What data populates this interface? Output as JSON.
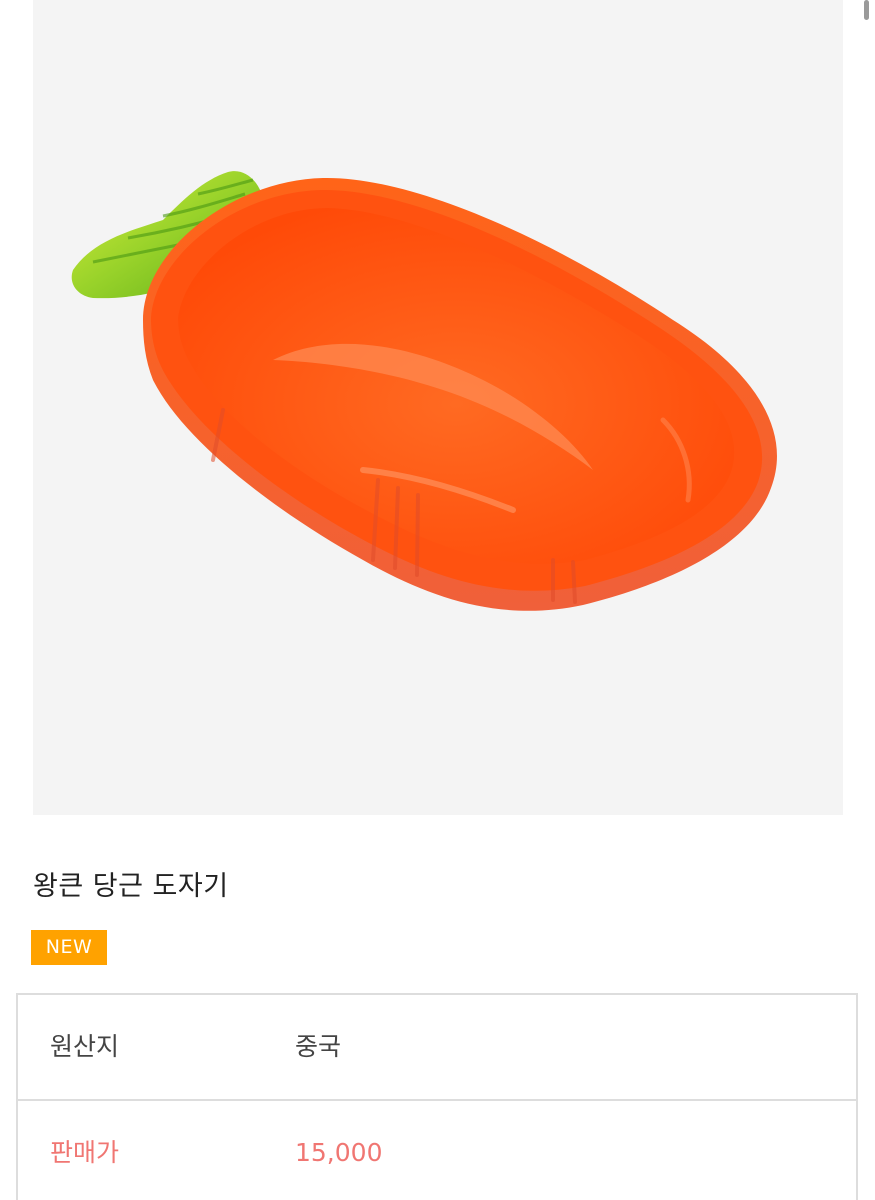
{
  "product": {
    "image_alt": "carrot-shaped ceramic bowl",
    "title": "왕큰 당근 도자기",
    "badge": "NEW"
  },
  "info_table": {
    "rows": [
      {
        "label": "원산지",
        "value": "중국"
      },
      {
        "label": "판매가",
        "value": "15,000"
      }
    ]
  },
  "colors": {
    "badge_bg": "#ffa200",
    "price_text": "#f07672",
    "bowl_orange": "#ff5a14",
    "leaf_green": "#8ccc22"
  }
}
